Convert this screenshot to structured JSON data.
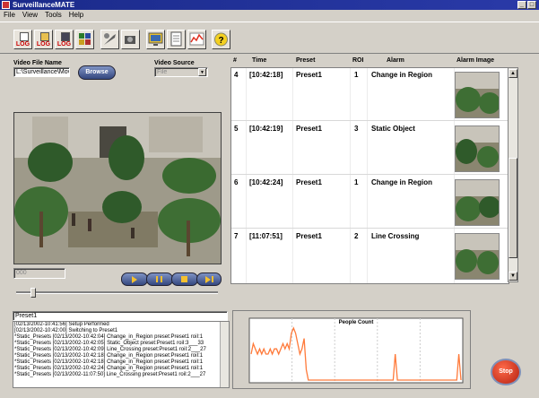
{
  "window": {
    "title": "SurveillanceMATE"
  },
  "menu": [
    "File",
    "View",
    "Tools",
    "Help"
  ],
  "toolbar": {
    "log_label": "LOG"
  },
  "left": {
    "video_file_label": "Video File Name",
    "video_file_value": "L:\\Surveillance\\Mov",
    "browse_label": "Browse",
    "video_source_label": "Video Source",
    "video_source_value": "File",
    "frame_counter": "000"
  },
  "table": {
    "headers": [
      "#",
      "Time",
      "Preset",
      "ROI",
      "Alarm",
      "Alarm Image"
    ],
    "rows": [
      {
        "num": "4",
        "time": "[10:42:18]",
        "preset": "Preset1",
        "roi": "1",
        "alarm": "Change in Region"
      },
      {
        "num": "5",
        "time": "[10:42:19]",
        "preset": "Preset1",
        "roi": "3",
        "alarm": "Static Object"
      },
      {
        "num": "6",
        "time": "[10:42:24]",
        "preset": "Preset1",
        "roi": "1",
        "alarm": "Change in Region"
      },
      {
        "num": "7",
        "time": "[11:07:51]",
        "preset": "Preset1",
        "roi": "2",
        "alarm": "Line Crossing"
      }
    ]
  },
  "preset_field": "Preset1",
  "log_lines": [
    "[02/13/2002-10:41:56] Setup Performed",
    "[02/13/2002-10:42:00] Switching to Preset1",
    "*Static_Presets [02/13/2002-10:42:04] Change_in_Region preset:Preset1 roiI:1",
    "*Static_Presets [02/13/2002-10:42:05] Static_Object preset:Preset1 roiI:3___33",
    "*Static_Presets [02/13/2002-10:42:09] Line_Crossing preset:Preset1 roiI:2___27",
    "*Static_Presets [02/13/2002-10:42:18] Change_in_Region preset:Preset1 roiI:1",
    "*Static_Presets [02/13/2002-10:42:18] Change_in_Region preset:Preset1 roiI:1",
    "*Static_Presets [02/13/2002-10:42:24] Change_in_Region preset:Preset1 roiI:1",
    "*Static_Presets [02/13/2002-11:07:50] Line_Crossing preset:Preset1 roiI:2___27"
  ],
  "stop_label": "Stop",
  "chart_data": {
    "type": "line",
    "title": "People Count",
    "x": [
      0,
      1,
      2,
      3,
      4,
      5,
      6,
      7,
      8,
      9,
      10,
      11,
      12,
      13,
      14,
      15,
      16,
      17,
      18,
      19,
      20,
      21,
      22,
      23,
      24,
      25,
      26,
      27,
      28,
      29,
      30,
      31,
      32,
      33,
      34,
      35,
      36,
      37,
      38,
      39,
      40,
      41,
      42,
      43,
      44,
      45,
      46,
      47,
      48,
      49,
      50,
      51,
      52,
      53,
      54,
      55,
      56,
      57,
      58,
      59,
      60,
      61,
      62,
      63,
      64,
      65,
      66,
      67,
      68,
      69,
      70,
      71,
      72,
      73,
      74,
      75,
      76,
      77,
      78,
      79,
      80,
      81,
      82,
      83,
      84,
      85,
      86,
      87,
      88,
      89,
      90,
      91,
      92,
      93,
      94,
      95,
      96,
      97,
      98,
      99
    ],
    "series": [
      {
        "color": "#ff7a3a",
        "values": [
          5,
          7,
          6,
          5,
          6,
          5,
          6,
          5,
          5,
          6,
          5,
          6,
          6,
          5,
          6,
          7,
          6,
          7,
          6,
          9,
          10,
          9,
          7,
          5,
          6,
          8,
          2,
          0,
          0,
          0,
          0,
          0,
          0,
          0,
          0,
          0,
          0,
          0,
          0,
          0,
          0,
          0,
          0,
          0,
          0,
          0,
          0,
          0,
          0,
          0,
          0,
          0,
          0,
          0,
          0,
          0,
          0,
          0,
          0,
          0,
          0,
          0,
          0,
          0,
          0,
          0,
          0,
          0,
          5,
          0,
          0,
          0,
          0,
          0,
          0,
          0,
          0,
          0,
          0,
          0,
          0,
          0,
          0,
          0,
          0,
          0,
          0,
          0,
          0,
          0,
          0,
          0,
          0,
          0,
          0,
          0,
          0,
          0,
          5,
          0
        ]
      }
    ],
    "ylim": [
      0,
      10
    ],
    "grid": true
  }
}
